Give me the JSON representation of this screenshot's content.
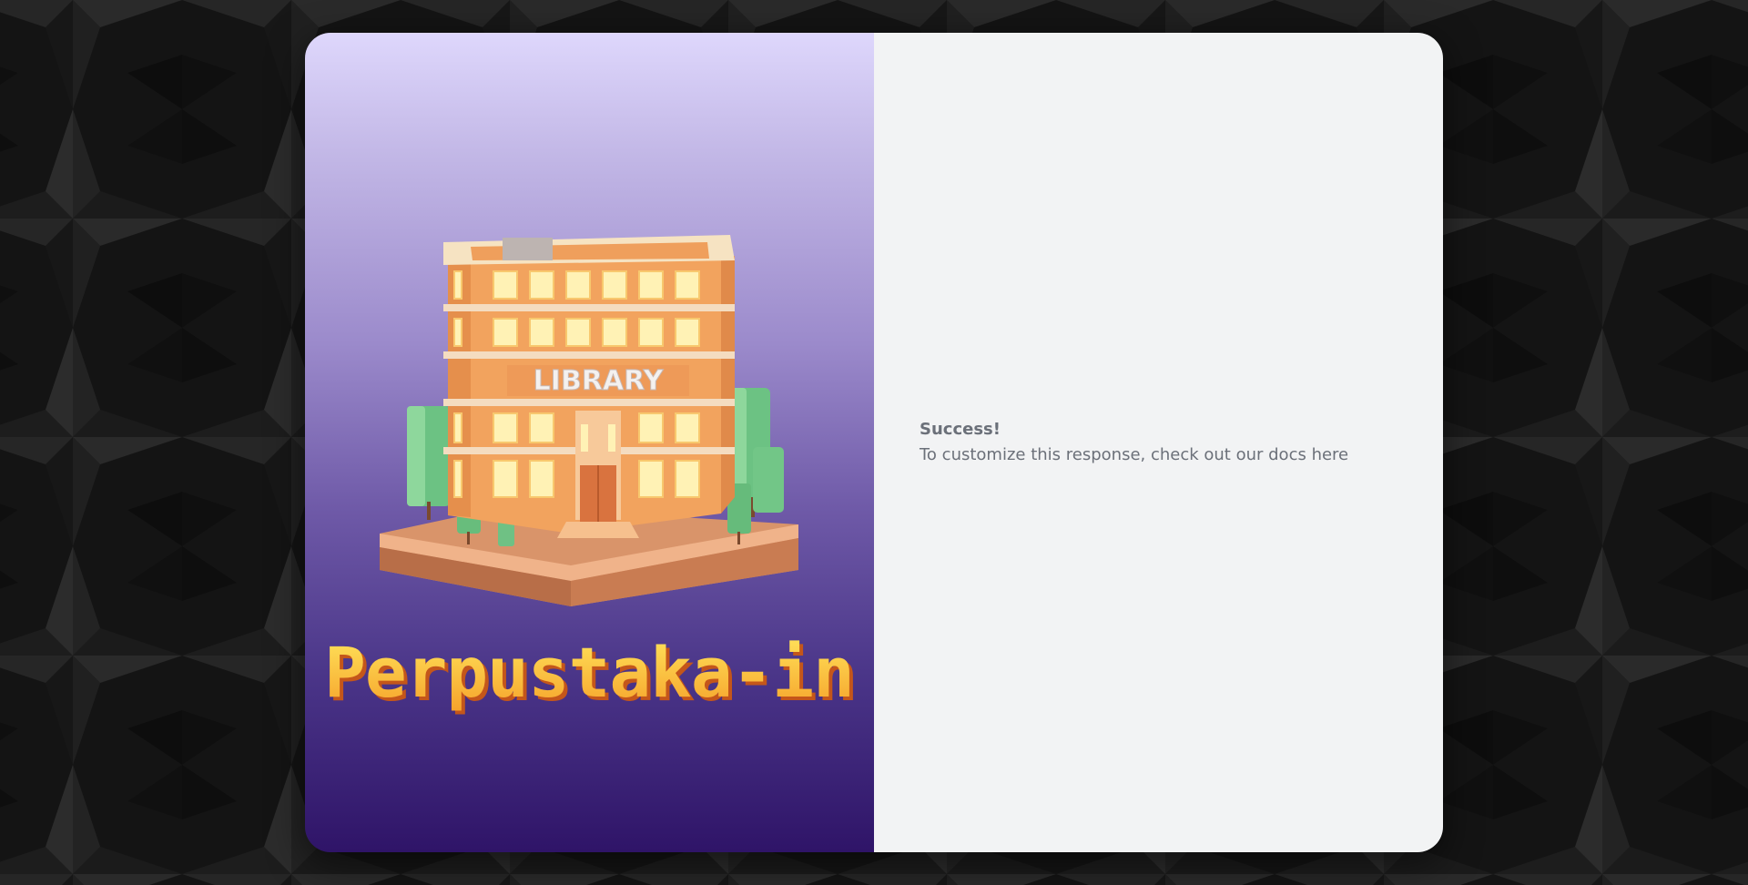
{
  "brand": {
    "building_sign": "LIBRARY",
    "app_name": "Perpustaka-in"
  },
  "response": {
    "title": "Success!",
    "message": "To customize this response, check out our docs here"
  },
  "colors": {
    "page_background": "#161616",
    "panel_gradient_top": "#ded7fc",
    "panel_gradient_bottom": "#2f1468",
    "result_background": "#f2f3f4",
    "text_gray": "#6b7079",
    "logo_yellow": "#ffd23f",
    "logo_orange": "#f28a1e"
  }
}
